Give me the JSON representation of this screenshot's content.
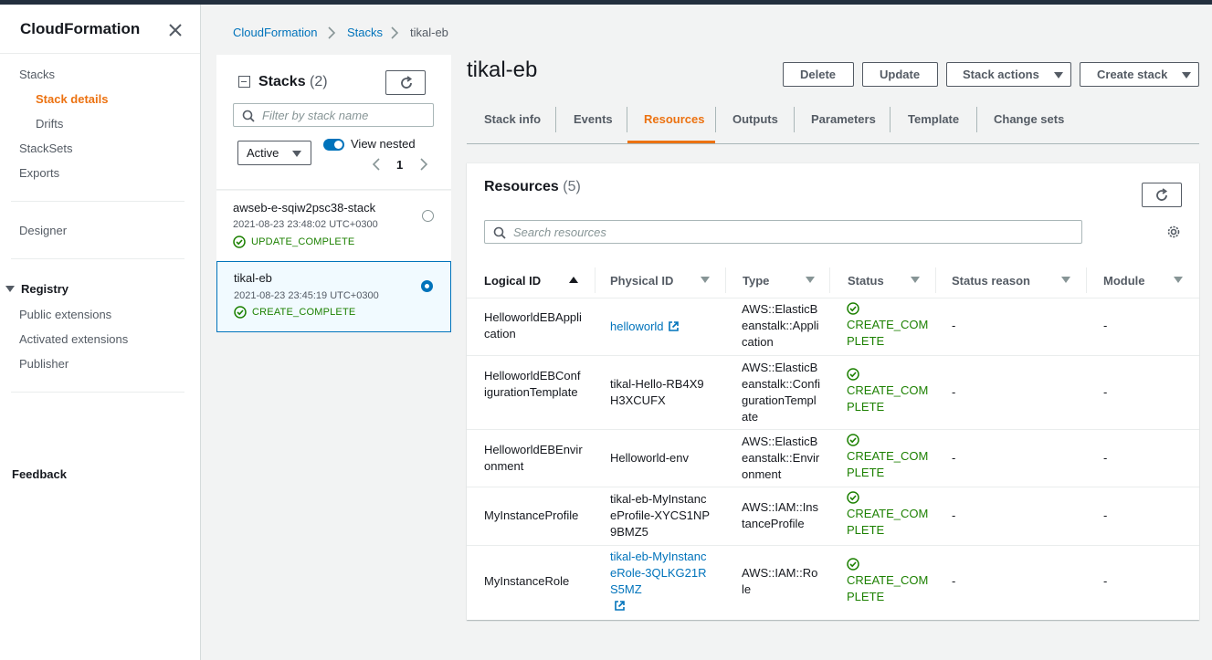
{
  "sidebar": {
    "title": "CloudFormation",
    "items": [
      {
        "label": "Stacks"
      },
      {
        "label": "Stack details"
      },
      {
        "label": "Drifts"
      },
      {
        "label": "StackSets"
      },
      {
        "label": "Exports"
      },
      {
        "label": "Designer"
      },
      {
        "label": "Registry"
      },
      {
        "label": "Public extensions"
      },
      {
        "label": "Activated extensions"
      },
      {
        "label": "Publisher"
      },
      {
        "label": "Feedback"
      }
    ]
  },
  "breadcrumb": [
    "CloudFormation",
    "Stacks",
    "tikal-eb"
  ],
  "stacks": {
    "title": "Stacks",
    "count": "(2)",
    "filter_placeholder": "Filter by stack name",
    "status_filter": "Active",
    "view_nested_label": "View nested",
    "page": "1",
    "items": [
      {
        "name": "awseb-e-sqiw2psc38-stack",
        "date": "2021-08-23 23:48:02 UTC+0300",
        "status": "UPDATE_COMPLETE",
        "selected": false
      },
      {
        "name": "tikal-eb",
        "date": "2021-08-23 23:45:19 UTC+0300",
        "status": "CREATE_COMPLETE",
        "selected": true
      }
    ]
  },
  "detail": {
    "title": "tikal-eb",
    "buttons": {
      "delete": "Delete",
      "update": "Update",
      "stack_actions": "Stack actions",
      "create_stack": "Create stack"
    },
    "tabs": [
      "Stack info",
      "Events",
      "Resources",
      "Outputs",
      "Parameters",
      "Template",
      "Change sets"
    ],
    "active_tab": "Resources"
  },
  "resources": {
    "title": "Resources",
    "count": "(5)",
    "search_placeholder": "Search resources",
    "columns": [
      "Logical ID",
      "Physical ID",
      "Type",
      "Status",
      "Status reason",
      "Module"
    ],
    "rows": [
      {
        "logical": "HelloworldEBApplication",
        "physical": "helloworld",
        "physical_link": true,
        "type": "AWS::ElasticBeanstalk::Application",
        "status": "CREATE_COMPLETE",
        "reason": "-",
        "module": "-"
      },
      {
        "logical": "HelloworldEBConfigurationTemplate",
        "physical": "tikal-Hello-RB4X9H3XCUFX",
        "physical_link": false,
        "type": "AWS::ElasticBeanstalk::ConfigurationTemplate",
        "status": "CREATE_COMPLETE",
        "reason": "-",
        "module": "-"
      },
      {
        "logical": "HelloworldEBEnvironment",
        "physical": "Helloworld-env",
        "physical_link": false,
        "type": "AWS::ElasticBeanstalk::Environment",
        "status": "CREATE_COMPLETE",
        "reason": "-",
        "module": "-"
      },
      {
        "logical": "MyInstanceProfile",
        "physical": "tikal-eb-MyInstanceProfile-XYCS1NP9BMZ5",
        "physical_link": false,
        "type": "AWS::IAM::InstanceProfile",
        "status": "CREATE_COMPLETE",
        "reason": "-",
        "module": "-"
      },
      {
        "logical": "MyInstanceRole",
        "physical": "tikal-eb-MyInstanceRole-3QLKG21RS5MZ",
        "physical_link": true,
        "type": "AWS::IAM::Role",
        "status": "CREATE_COMPLETE",
        "reason": "-",
        "module": "-"
      }
    ]
  },
  "colors": {
    "accent": "#ec7211",
    "link": "#0073bb",
    "success": "#1d8102"
  }
}
